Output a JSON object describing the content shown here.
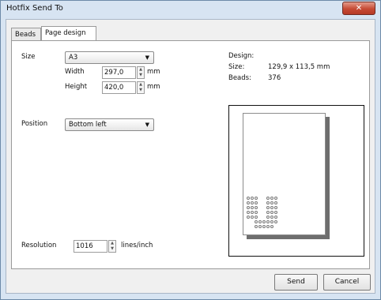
{
  "window": {
    "title": "Hotfix Send To",
    "close_symbol": "✕"
  },
  "tabs": [
    {
      "label": "Beads"
    },
    {
      "label": "Page design"
    }
  ],
  "page_size": {
    "size_label": "Size",
    "size_value": "A3",
    "width_label": "Width",
    "width_value": "297,0",
    "height_label": "Height",
    "height_value": "420,0",
    "unit_mm": "mm"
  },
  "position": {
    "label": "Position",
    "value": "Bottom left"
  },
  "resolution": {
    "label": "Resolution",
    "value": "1016",
    "unit": "lines/inch"
  },
  "design_info": {
    "heading": "Design:",
    "size_label": "Size:",
    "size_value": "129,9 x 113,5 mm",
    "beads_label": "Beads:",
    "beads_value": "376"
  },
  "buttons": {
    "send": "Send",
    "cancel": "Cancel"
  }
}
